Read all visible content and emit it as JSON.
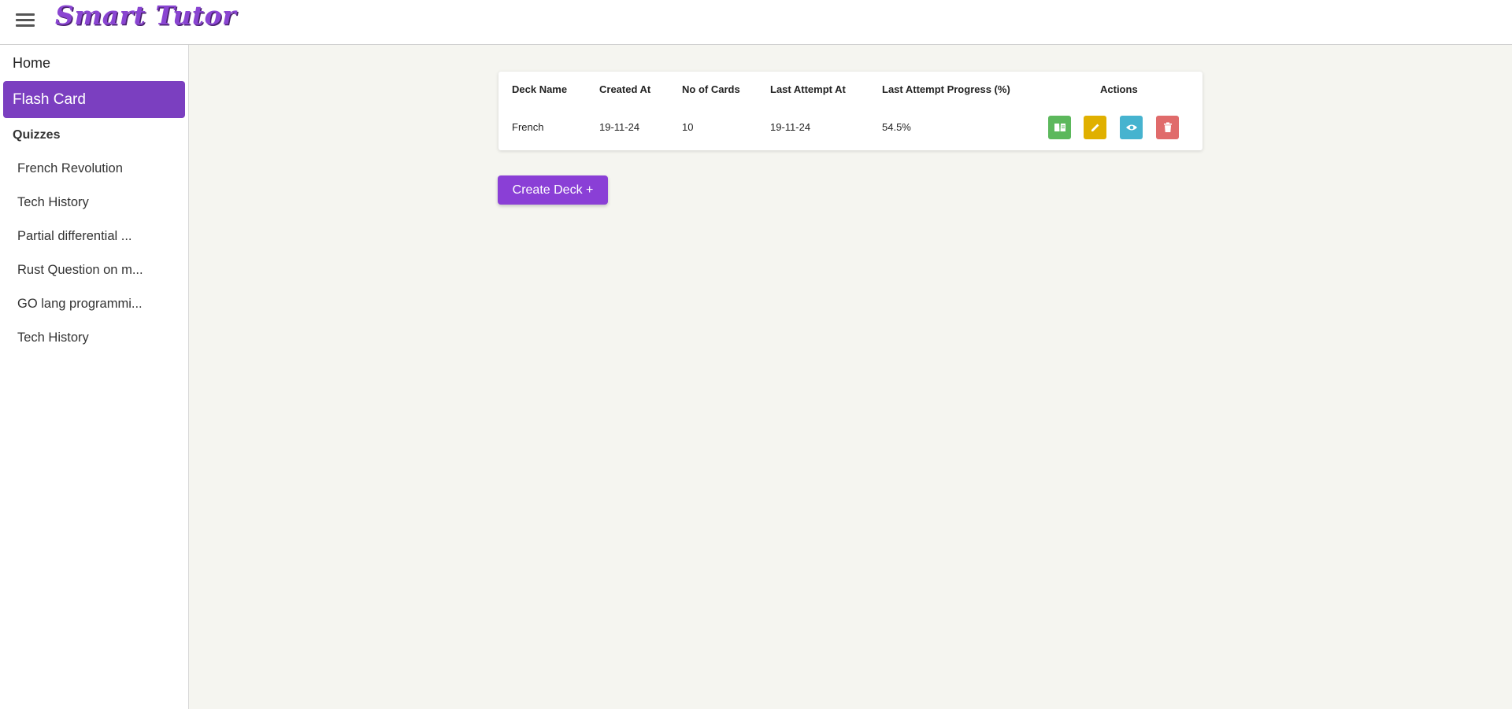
{
  "header": {
    "app_title": "Smart Tutor"
  },
  "sidebar": {
    "home": "Home",
    "flash_card": "Flash Card",
    "quizzes_heading": "Quizzes",
    "quizzes": [
      "French Revolution",
      "Tech History",
      "Partial differential ...",
      "Rust Question on m...",
      "GO lang programmi...",
      "Tech History"
    ]
  },
  "table": {
    "headers": [
      "Deck Name",
      "Created At",
      "No of Cards",
      "Last Attempt At",
      "Last Attempt Progress (%)",
      "Actions"
    ],
    "rows": [
      {
        "deck_name": "French",
        "created_at": "19-11-24",
        "no_of_cards": "10",
        "last_attempt_at": "19-11-24",
        "progress": "54.5%"
      }
    ],
    "actions": [
      {
        "icon": "book-icon",
        "color": "#5cb85c"
      },
      {
        "icon": "pencil-icon",
        "color": "#e0b000"
      },
      {
        "icon": "eye-icon",
        "color": "#46b3cf"
      },
      {
        "icon": "trash-icon",
        "color": "#e06b6b"
      }
    ]
  },
  "create_button": "Create Deck +",
  "colors": {
    "accent": "#7b3fc0",
    "button": "#8a3fd6",
    "background": "#f5f5f0"
  }
}
